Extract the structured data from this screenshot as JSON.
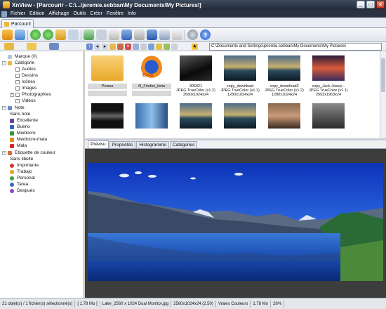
{
  "window": {
    "title": "XnView - [Parcourir - C:\\...\\jeremie.sebban\\My Documents\\My Pictures\\]",
    "buttons": [
      "_",
      "□",
      "×"
    ]
  },
  "menu": [
    "Fichier",
    "Edition",
    "Affichage",
    "Outils",
    "Créer",
    "Fenêtre",
    "Info"
  ],
  "main_tab": "Parcourir",
  "address": "C:\\Documents and Settings\\jeremie.sebban\\My Documents\\My Pictures\\",
  "tree": {
    "rows": [
      {
        "label": "Marque (0)",
        "indent": 0,
        "icon": "bookmark-icon"
      },
      {
        "label": "Catégorie",
        "indent": 0,
        "expander": "-",
        "icon": "folder-icon"
      },
      {
        "label": "Audios",
        "indent": 2,
        "check": true
      },
      {
        "label": "Dessins",
        "indent": 2,
        "check": true
      },
      {
        "label": "Icônes",
        "indent": 2,
        "check": true
      },
      {
        "label": "Images",
        "indent": 2,
        "check": true
      },
      {
        "label": "Photographies",
        "indent": 2,
        "check": true,
        "expander": "+"
      },
      {
        "label": "Vidéos",
        "indent": 2,
        "check": true
      },
      {
        "label": "Note",
        "indent": 0,
        "expander": "-",
        "icon": "note-icon"
      },
      {
        "label": "Sans note",
        "indent": 2
      },
      {
        "label": "Excellente",
        "indent": 2,
        "square": "#6b3fa0"
      },
      {
        "label": "Bueno",
        "indent": 2,
        "square": "#3a62c4"
      },
      {
        "label": "Mediocre",
        "indent": 2,
        "square": "#2f9a3a"
      },
      {
        "label": "Mediocre-mala",
        "indent": 2,
        "square": "#e08a1c"
      },
      {
        "label": "Mala",
        "indent": 2,
        "square": "#d42a2a"
      },
      {
        "label": "Etiquette de couleur",
        "indent": 0,
        "expander": "-",
        "icon": "label-icon"
      },
      {
        "label": "Sans libellé",
        "indent": 2
      },
      {
        "label": "Importante",
        "indent": 2,
        "dot": "#d53a2a"
      },
      {
        "label": "Trabajo",
        "indent": 2,
        "dot": "#e6a21c"
      },
      {
        "label": "Personal",
        "indent": 2,
        "dot": "#3aa23a"
      },
      {
        "label": "Tarea",
        "indent": 2,
        "dot": "#3a6ac8"
      },
      {
        "label": "Después",
        "indent": 2,
        "dot": "#8a4ac0"
      }
    ]
  },
  "thumbnails": [
    {
      "name": "Picasa",
      "info": [],
      "kind": "folder"
    },
    {
      "name": "0l_Firefox_beta",
      "info": [],
      "kind": "firefox"
    },
    {
      "name": "",
      "info": [
        "306921",
        "JPEG TrueColor (v1.2)",
        "2560x1024x24"
      ],
      "kind": "dark-wide"
    },
    {
      "name": "copy_download",
      "info": [
        "JPEG TrueColor (v1.1)",
        "1280x1024x24"
      ],
      "kind": "sea-night"
    },
    {
      "name": "copy_download2",
      "info": [
        "JPEG TrueColor (v1.2)",
        "1280x1024x24"
      ],
      "kind": "sea-night"
    },
    {
      "name": "copy_Jack Josep...",
      "info": [
        "JPEG TrueColor (v1.1)",
        "2953x1963x24"
      ],
      "kind": "city-night"
    },
    {
      "name": "",
      "info": [],
      "kind": "dark-wide2"
    },
    {
      "name": "",
      "info": [],
      "kind": "blue-building"
    },
    {
      "name": "",
      "info": [],
      "kind": "sea-night"
    },
    {
      "name": "",
      "info": [],
      "kind": "sea-night"
    },
    {
      "name": "",
      "info": [],
      "kind": "portrait"
    },
    {
      "name": "",
      "info": [],
      "kind": "dark-moody"
    }
  ],
  "preview_tabs": [
    "Prévisu",
    "Propriétés",
    "Histogramme",
    "Catégories"
  ],
  "status": [
    "21 objet(s) / 1 fichier(s) sélectionné(s)",
    "[ 1.78 Mo ]",
    "Lake_2560 x 1024 Dual Monitor.jpg",
    "2560x1024x24 (2.50)",
    "Vraies Couleurs",
    "1.78 Mo",
    "28%"
  ],
  "colors": {
    "titlebar": "#2b3342",
    "accent": "#3a6ac8"
  }
}
